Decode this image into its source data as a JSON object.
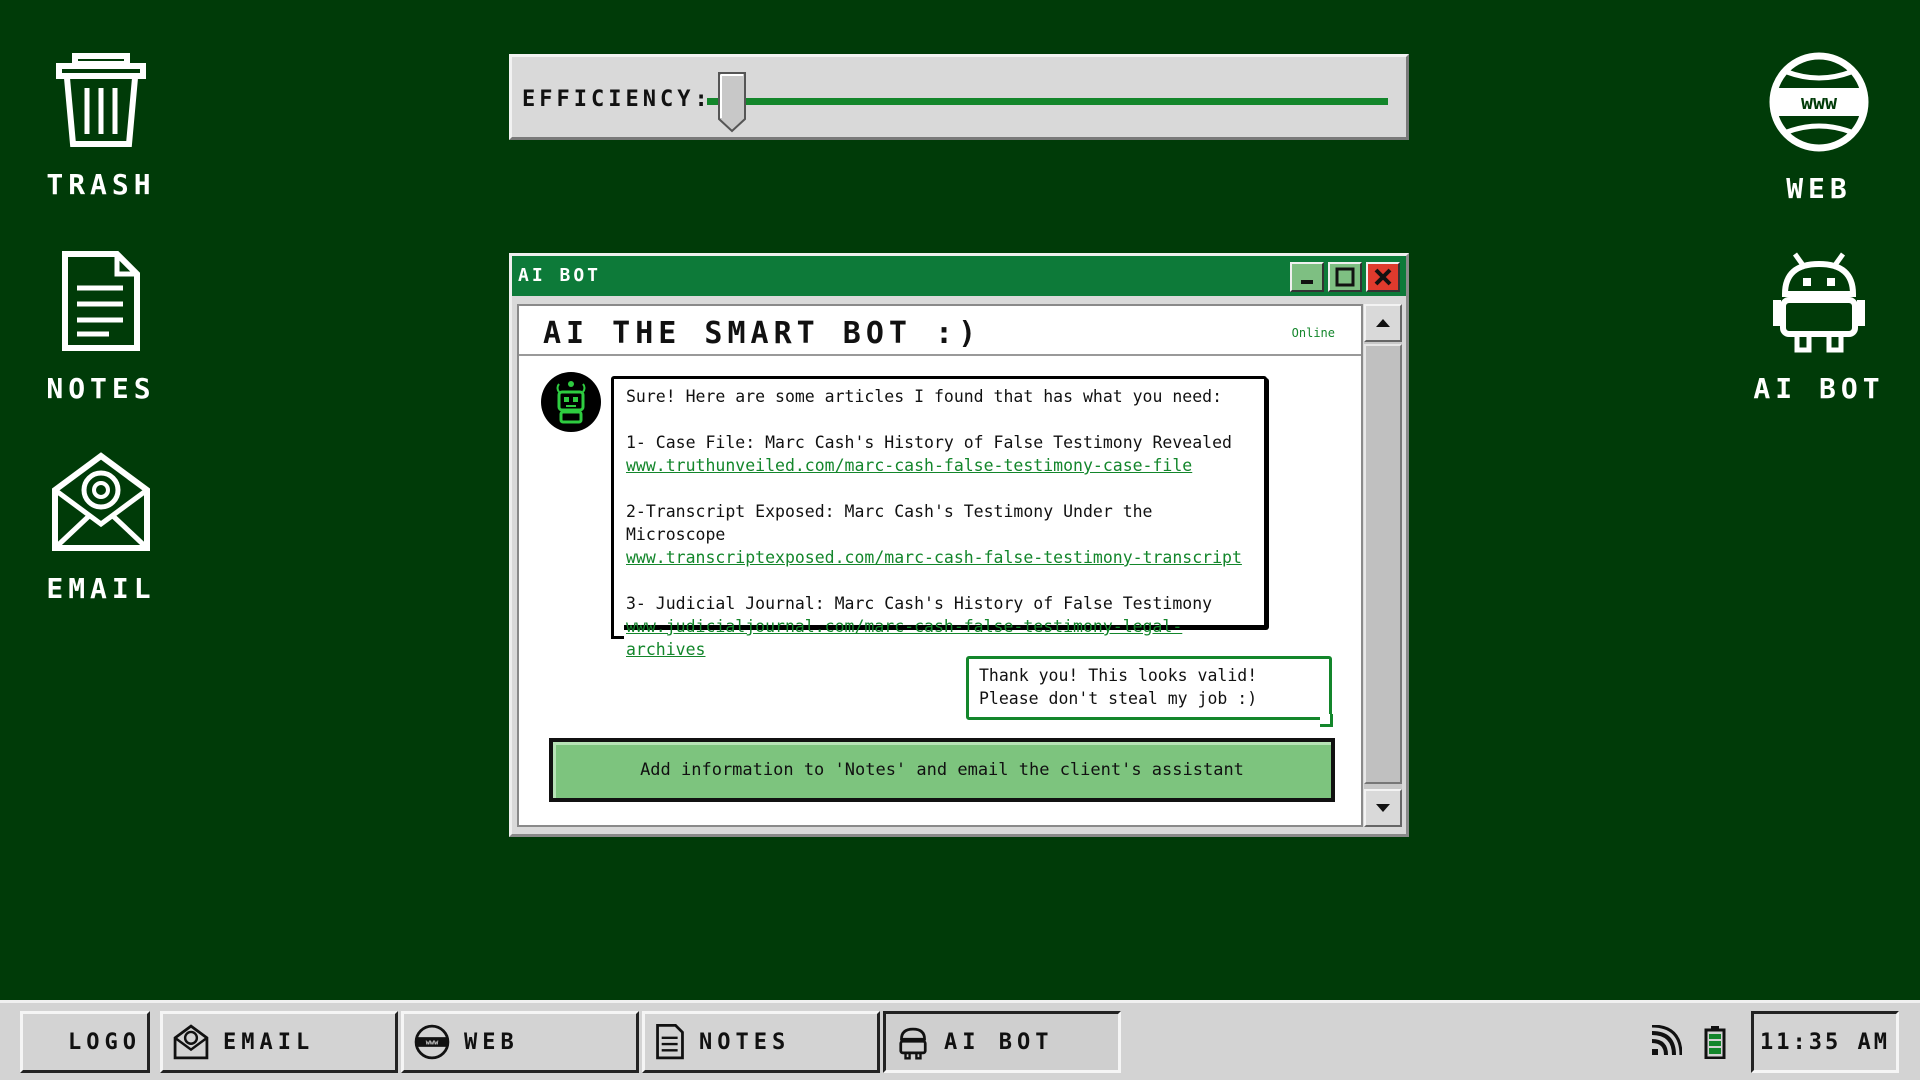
{
  "desktop": {
    "left_icons": [
      {
        "label": "TRASH",
        "icon": "trash-icon"
      },
      {
        "label": "NOTES",
        "icon": "notes-icon"
      },
      {
        "label": "EMAIL",
        "icon": "email-icon"
      }
    ],
    "right_icons": [
      {
        "label": "WEB",
        "icon": "web-globe-icon"
      },
      {
        "label": "AI BOT",
        "icon": "ai-bot-icon"
      }
    ]
  },
  "efficiency": {
    "label": "EFFICIENCY:",
    "level": 0.02
  },
  "window": {
    "title": "AI BOT",
    "chat_title": "AI THE SMART BOT :)",
    "status": "Online",
    "bot_message": {
      "intro": "Sure! Here are some articles I found that has what you need:",
      "articles": [
        {
          "title": "1- Case File: Marc Cash's History of False Testimony Revealed",
          "url": "www.truthunveiled.com/marc-cash-false-testimony-case-file"
        },
        {
          "title": "2-Transcript Exposed: Marc Cash's Testimony Under the Microscope",
          "url": "www.transcriptexposed.com/marc-cash-false-testimony-transcript"
        },
        {
          "title": "3- Judicial Journal: Marc Cash's History of False Testimony",
          "url": "www.judicialjournal.com/marc-cash-false-testimony-legal-archives"
        }
      ]
    },
    "user_message": "Thank you! This looks valid! Please don't steal my job :)",
    "action_button": "Add information to 'Notes' and email the client's assistant"
  },
  "taskbar": {
    "logo": "LOGO",
    "items": [
      {
        "label": "EMAIL",
        "icon": "email-icon"
      },
      {
        "label": "WEB",
        "icon": "web-globe-icon"
      },
      {
        "label": "NOTES",
        "icon": "notes-icon"
      },
      {
        "label": "AI BOT",
        "icon": "ai-bot-icon",
        "active": true
      }
    ],
    "tray": [
      "wifi-signal-icon",
      "battery-icon"
    ],
    "clock": "11:35 AM"
  },
  "colors": {
    "desktop_bg": "#003b08",
    "accent_green": "#13862b",
    "title_bar": "#0d7a39",
    "button_green": "#7dc47e",
    "close_red": "#e03a2d"
  }
}
